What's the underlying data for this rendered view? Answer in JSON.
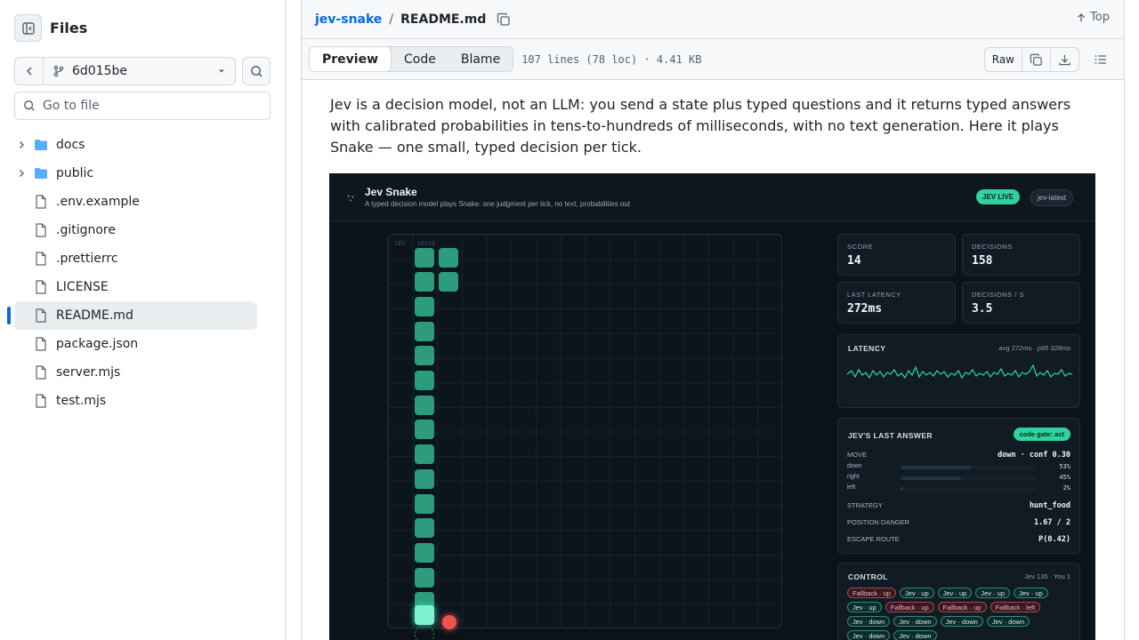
{
  "sidebar": {
    "title": "Files",
    "branch": "6d015be",
    "goto_placeholder": "Go to file",
    "items": [
      {
        "label": "docs",
        "type": "folder"
      },
      {
        "label": "public",
        "type": "folder"
      },
      {
        "label": ".env.example",
        "type": "file"
      },
      {
        "label": ".gitignore",
        "type": "file"
      },
      {
        "label": ".prettierrc",
        "type": "file"
      },
      {
        "label": "LICENSE",
        "type": "file"
      },
      {
        "label": "README.md",
        "type": "file",
        "active": true
      },
      {
        "label": "package.json",
        "type": "file"
      },
      {
        "label": "server.mjs",
        "type": "file"
      },
      {
        "label": "test.mjs",
        "type": "file"
      }
    ]
  },
  "header": {
    "repo": "jev-snake",
    "separator": "/",
    "file": "README.md",
    "top_label": "Top"
  },
  "toolbar": {
    "tabs": [
      "Preview",
      "Code",
      "Blame"
    ],
    "meta": "107 lines (78 loc) · 4.41 KB",
    "raw_label": "Raw"
  },
  "readme": {
    "intro": "Jev is a decision model, not an LLM: you send a state plus typed questions and it returns typed answers with calibrated probabilities in tens-to-hundreds of milliseconds, with no text generation. Here it plays Snake — one small, typed decision per tick."
  },
  "app": {
    "title": "Jev Snake",
    "subtitle": "A typed decision model plays Snake: one judgment per tick, no text, probabilities out",
    "live_pill": "JEV LIVE",
    "model_pill": "jev-latest",
    "board_tag": "JEV · 16x16",
    "stats": [
      {
        "label": "SCORE",
        "value": "14"
      },
      {
        "label": "DECISIONS",
        "value": "158"
      },
      {
        "label": "LAST LATENCY",
        "value": "272ms"
      },
      {
        "label": "DECISIONS / S",
        "value": "3.5"
      }
    ],
    "latency": {
      "title": "LATENCY",
      "summary": "avg 272ms · p95 328ms"
    },
    "answer": {
      "title": "JEV'S LAST ANSWER",
      "gate": "code gate: act",
      "move_label": "MOVE",
      "move_value": "down · conf 0.30",
      "probs": [
        {
          "dir": "down",
          "pct": "53%",
          "p": 0.53
        },
        {
          "dir": "right",
          "pct": "45%",
          "p": 0.45
        },
        {
          "dir": "left",
          "pct": "2%",
          "p": 0.02
        }
      ],
      "strategy_label": "STRATEGY",
      "strategy_value": "hunt_food",
      "danger_label": "POSITION DANGER",
      "danger_value": "1.67 / 2",
      "escape_label": "ESCAPE ROUTE",
      "escape_value": "P(0.42)"
    },
    "control": {
      "title": "CONTROL",
      "score": "Jev 135 · You 1",
      "chips": [
        {
          "t": "Fallback · up",
          "k": "fb"
        },
        {
          "t": "Jev · up",
          "k": "jv"
        },
        {
          "t": "Jev · up",
          "k": "jv"
        },
        {
          "t": "Jev · up",
          "k": "jv"
        },
        {
          "t": "Jev · up",
          "k": "jv"
        },
        {
          "t": "Jev · up",
          "k": "jv"
        },
        {
          "t": "Fallback · up",
          "k": "fb"
        },
        {
          "t": "Fallback · up",
          "k": "fb"
        },
        {
          "t": "Fallback · left",
          "k": "fb"
        },
        {
          "t": "Jev · down",
          "k": "jv"
        },
        {
          "t": "Jev · down",
          "k": "jv"
        },
        {
          "t": "Jev · down",
          "k": "jv"
        },
        {
          "t": "Jev · down",
          "k": "jv"
        },
        {
          "t": "Jev · down",
          "k": "jv"
        },
        {
          "t": "Jev · down",
          "k": "jv"
        }
      ]
    },
    "colors": {
      "accent": "#2fd39f",
      "snake": "#2c9c7d",
      "food": "#ef5350",
      "link": "#0969da"
    }
  }
}
